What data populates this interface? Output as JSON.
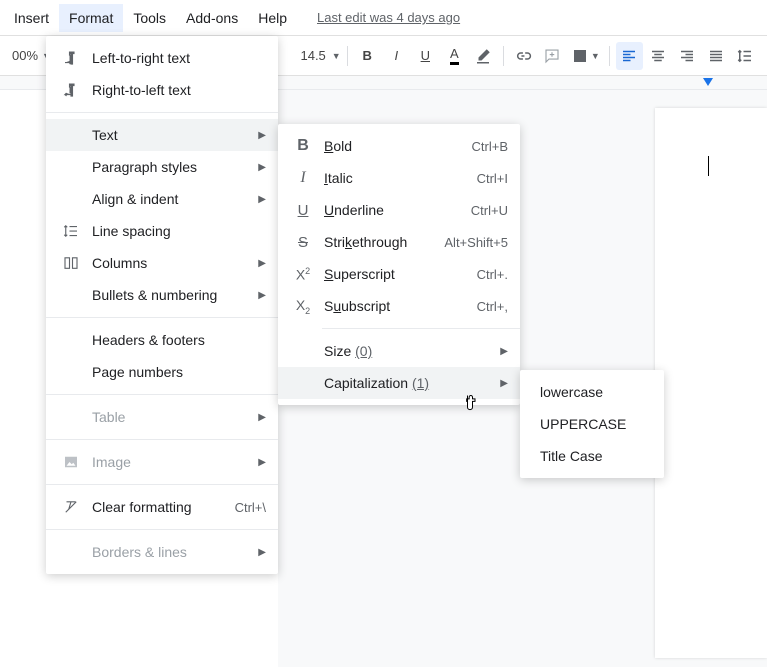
{
  "menubar": {
    "insert": "Insert",
    "format": "Format",
    "tools": "Tools",
    "addons": "Add-ons",
    "help": "Help",
    "lastEdit": "Last edit was 4 days ago"
  },
  "toolbar": {
    "zoom": "00%",
    "fontSize": "14.5"
  },
  "formatMenu": {
    "ltr": "Left-to-right text",
    "rtl": "Right-to-left text",
    "text": "Text",
    "paragraphStyles": "Paragraph styles",
    "alignIndent": "Align & indent",
    "lineSpacing": "Line spacing",
    "columns": "Columns",
    "bulletsNumbering": "Bullets & numbering",
    "headersFooters": "Headers & footers",
    "pageNumbers": "Page numbers",
    "table": "Table",
    "image": "Image",
    "clearFormatting": "Clear formatting",
    "clearFormattingSc": "Ctrl+\\",
    "bordersLines": "Borders & lines"
  },
  "textMenu": {
    "bold": "old",
    "boldSc": "Ctrl+B",
    "italic": "talic",
    "italicSc": "Ctrl+I",
    "underline": "nderline",
    "underlineSc": "Ctrl+U",
    "strikethrough": "ethrough",
    "strikePrefix": "Stri",
    "strikeSc": "Alt+Shift+5",
    "superscript": "uperscript",
    "superSc": "Ctrl+.",
    "subscript": "ubscript",
    "subSc": "Ctrl+,",
    "size": "Size",
    "sizeHint": "(0)",
    "capitalization": "Capitalization",
    "capHint": "(1)"
  },
  "capMenu": {
    "lower": "lowercase",
    "upper": "UPPERCASE",
    "title": "Title Case"
  }
}
